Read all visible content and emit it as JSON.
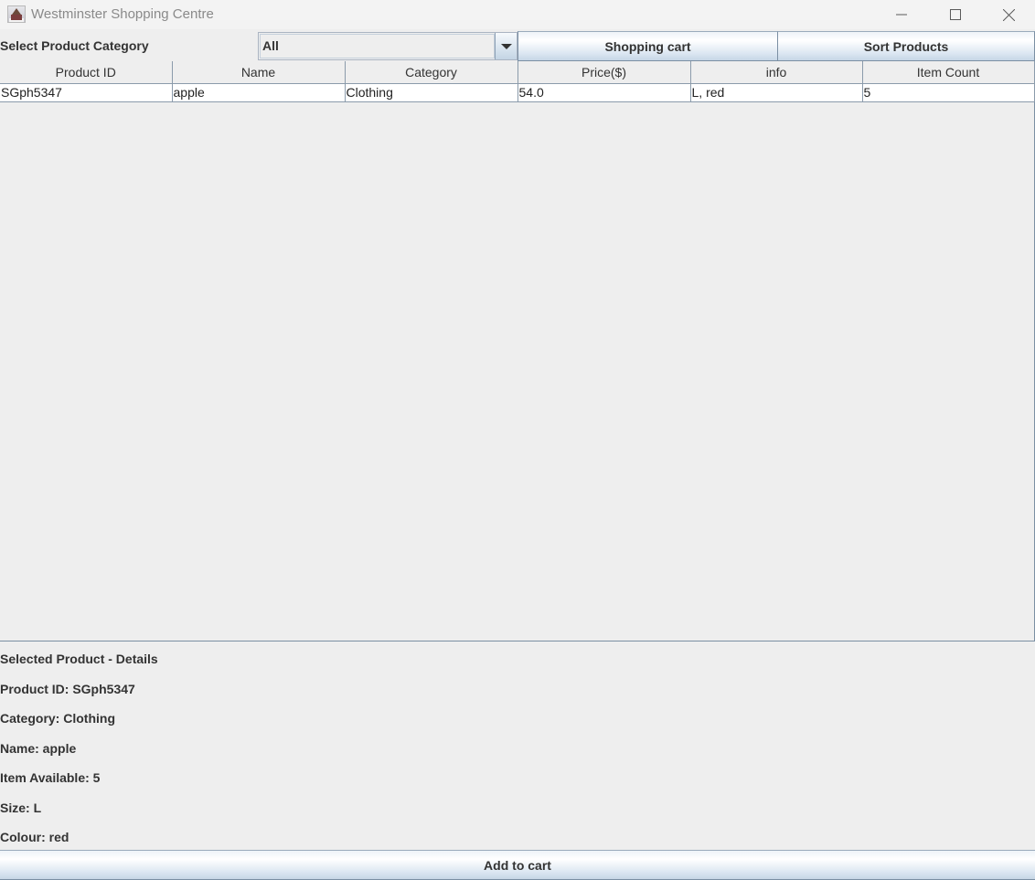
{
  "window": {
    "title": "Westminster Shopping Centre",
    "controls": {
      "minimize": "minimize-icon",
      "maximize": "maximize-icon",
      "close": "close-icon"
    }
  },
  "toolbar": {
    "category_label": "Select Product Category",
    "category_selected": "All",
    "shopping_cart_label": "Shopping cart",
    "sort_products_label": "Sort Products"
  },
  "table": {
    "columns": [
      "Product ID",
      "Name",
      "Category",
      "Price($)",
      "info",
      "Item Count"
    ],
    "rows": [
      [
        "SGph5347",
        "apple",
        "Clothing",
        "54.0",
        "L, red",
        "5"
      ]
    ]
  },
  "details": {
    "heading": "Selected Product - Details",
    "lines": [
      "Product ID: SGph5347",
      "Category: Clothing",
      "Name: apple",
      "Item Available: 5",
      "Size: L",
      "Colour: red"
    ]
  },
  "footer": {
    "add_to_cart_label": "Add to cart"
  }
}
